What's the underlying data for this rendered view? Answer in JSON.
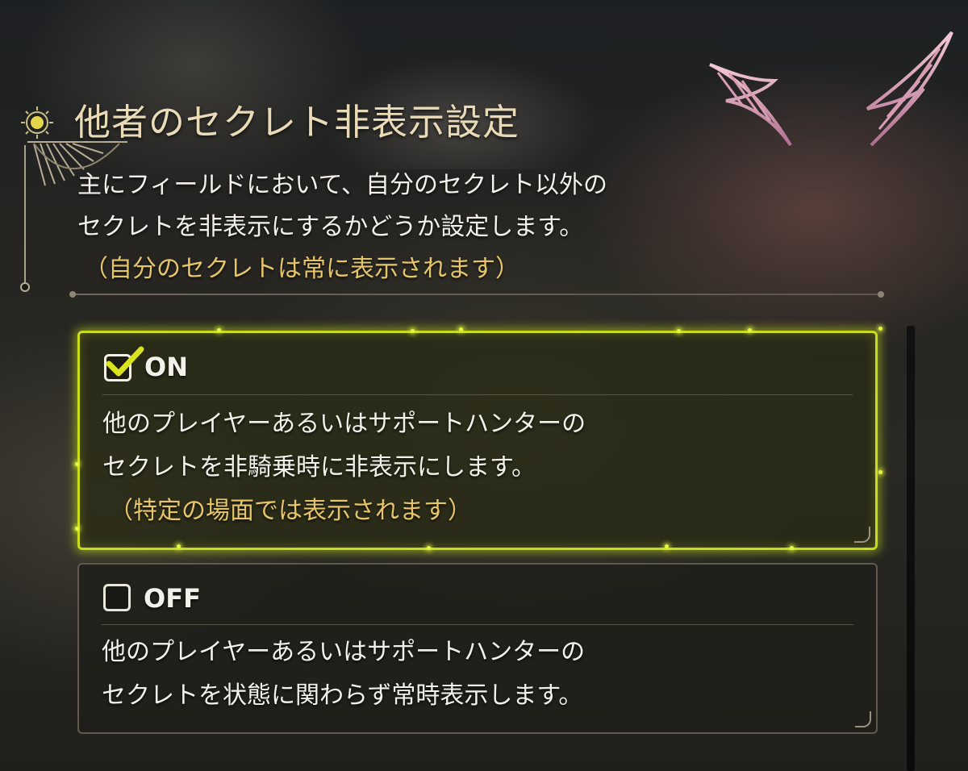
{
  "header": {
    "title": "他者のセクレト非表示設定",
    "icon": "sun-emblem-icon"
  },
  "description": {
    "line1": "主にフィールドにおいて、自分のセクレト以外の",
    "line2": "セクレトを非表示にするかどうか設定します。",
    "note": "（自分のセクレトは常に表示されます）"
  },
  "options": [
    {
      "label": "ON",
      "selected": true,
      "line1": "他のプレイヤーあるいはサポートハンターの",
      "line2": "セクレトを非騎乗時に非表示にします。",
      "note": "（特定の場面では表示されます）"
    },
    {
      "label": "OFF",
      "selected": false,
      "line1": "他のプレイヤーあるいはサポートハンターの",
      "line2": "セクレトを状態に関わらず常時表示します。"
    }
  ],
  "colors": {
    "accent": "#c8dc1c",
    "title": "#e9dbb7",
    "note": "#e6c56a",
    "text": "#f4f1ea"
  }
}
